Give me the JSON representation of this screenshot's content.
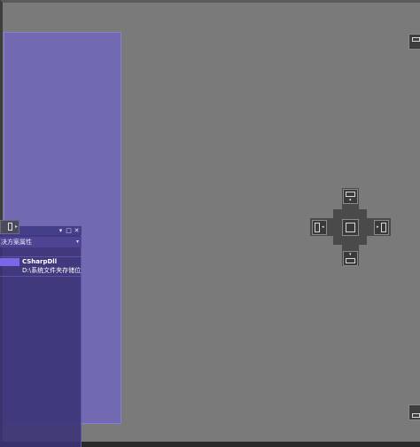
{
  "panel": {
    "title_tab": "决方案属性",
    "header_buttons": {
      "menu": "▾",
      "maximize": "□",
      "close": "✕"
    },
    "tab_dropdown": "▾",
    "properties": [
      {
        "value": "CSharpDll"
      },
      {
        "value": "D:\\系统文件夹存储位置\\"
      }
    ]
  },
  "icons": {
    "pin_tab": "dock-pin-icon",
    "dock_top": "dock-top-icon",
    "dock_left": "dock-left-icon",
    "dock_center": "dock-tabbed-icon",
    "dock_right": "dock-right-icon",
    "dock_bottom": "dock-bottom-icon",
    "edge_top_right": "dock-edge-top-icon",
    "edge_bottom_right": "dock-edge-bottom-icon"
  },
  "colors": {
    "dock_preview": "#6e64c8",
    "panel_bg": "#3a3276",
    "selection": "#7b66e8",
    "workspace": "#7a7a7a"
  }
}
